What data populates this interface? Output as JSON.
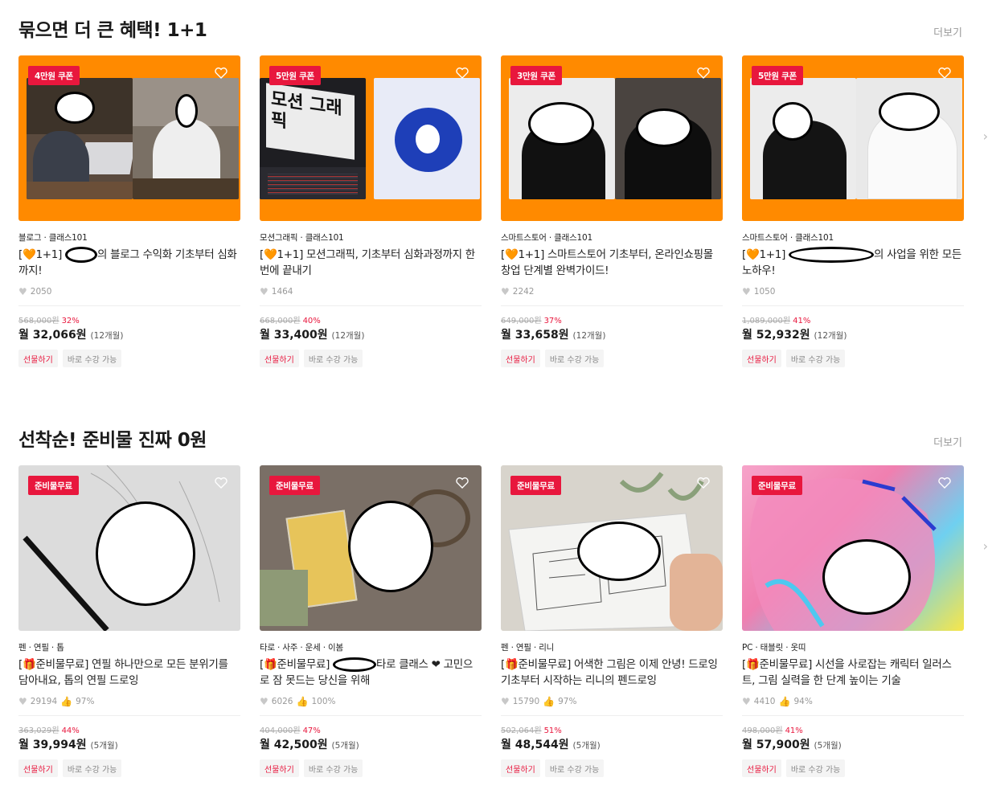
{
  "sections": [
    {
      "title": "묶으면 더 큰 혜택! 1+1",
      "more": "더보기",
      "next_arrow": "›",
      "cards": [
        {
          "badge": "4만원 쿠폰",
          "category": "블로그 · 클래스101",
          "title": "[🧡1+1] ",
          "title_rest": "의 블로그 수익화 기초부터 심화까지!",
          "stat1": "2050",
          "stat2": "",
          "original": "568,000원",
          "discount": "32%",
          "monthly": "월 32,066원",
          "months": "(12개월)",
          "gift": "선물하기",
          "now": "바로 수강 가능"
        },
        {
          "badge": "5만원 쿠폰",
          "category": "모션그래픽 · 클래스101",
          "title": "[🧡1+1] 모션그래픽, 기초부터 심화과정까지 한번에 끝내기",
          "title_rest": "",
          "stat1": "1464",
          "stat2": "",
          "original": "668,000원",
          "discount": "40%",
          "monthly": "월 33,400원",
          "months": "(12개월)",
          "gift": "선물하기",
          "now": "바로 수강 가능",
          "photo_text": "모션 그래픽"
        },
        {
          "badge": "3만원 쿠폰",
          "category": "스마트스토어 · 클래스101",
          "title": "[🧡1+1] 스마트스토어 기초부터, 온라인쇼핑몰창업 단계별 완벽가이드!",
          "title_rest": "",
          "stat1": "2242",
          "stat2": "",
          "original": "649,000원",
          "discount": "37%",
          "monthly": "월 33,658원",
          "months": "(12개월)",
          "gift": "선물하기",
          "now": "바로 수강 가능"
        },
        {
          "badge": "5만원 쿠폰",
          "category": "스마트스토어 · 클래스101",
          "title": "[🧡1+1] ",
          "title_rest": "의 사업을 위한 모든 노하우!",
          "stat1": "1050",
          "stat2": "",
          "original": "1,089,000원",
          "discount": "41%",
          "monthly": "월 52,932원",
          "months": "(12개월)",
          "gift": "선물하기",
          "now": "바로 수강 가능"
        }
      ]
    },
    {
      "title": "선착순! 준비물 진짜 0원",
      "more": "더보기",
      "next_arrow": "›",
      "cards": [
        {
          "badge": "준비물무료",
          "category": "펜 · 연필 · 톱",
          "title": "[🎁준비물무료] 연필 하나만으로 모든 분위기를 담아내요, 톱의 연필 드로잉",
          "title_rest": "",
          "stat1": "29194",
          "stat2": "97%",
          "original": "363,029원",
          "discount": "44%",
          "monthly": "월 39,994원",
          "months": "(5개월)",
          "gift": "선물하기",
          "now": "바로 수강 가능"
        },
        {
          "badge": "준비물무료",
          "category": "타로 · 사주 · 운세 · 이봄",
          "title": "[🎁준비물무료] ",
          "title_rest": "타로 클래스 ❤ 고민으로 잠 못드는 당신을 위해",
          "stat1": "6026",
          "stat2": "100%",
          "original": "404,000원",
          "discount": "47%",
          "monthly": "월 42,500원",
          "months": "(5개월)",
          "gift": "선물하기",
          "now": "바로 수강 가능"
        },
        {
          "badge": "준비물무료",
          "category": "펜 · 연필 · 리니",
          "title": "[🎁준비물무료] 어색한 그림은 이제 안녕! 드로잉 기초부터 시작하는 리니의 펜드로잉",
          "title_rest": "",
          "stat1": "15790",
          "stat2": "97%",
          "original": "502,064원",
          "discount": "51%",
          "monthly": "월 48,544원",
          "months": "(5개월)",
          "gift": "선물하기",
          "now": "바로 수강 가능"
        },
        {
          "badge": "준비물무료",
          "category": "PC · 태블릿 · 옷띠",
          "title": "[🎁준비물무료] 시선을 사로잡는 캐릭터 일러스트, 그림 실력을 한 단계 높이는 기술",
          "title_rest": "",
          "stat1": "4410",
          "stat2": "94%",
          "original": "498,000원",
          "discount": "41%",
          "monthly": "월 57,900원",
          "months": "(5개월)",
          "gift": "선물하기",
          "now": "바로 수강 가능"
        }
      ]
    }
  ],
  "colors": {
    "coupon_bg": "#ff8a00",
    "badge": "#e8173d",
    "discount": "#e8173d"
  },
  "icons": [
    "heart-outline-icon",
    "heart-filled-icon",
    "thumbs-up-icon",
    "chevron-right-icon"
  ]
}
